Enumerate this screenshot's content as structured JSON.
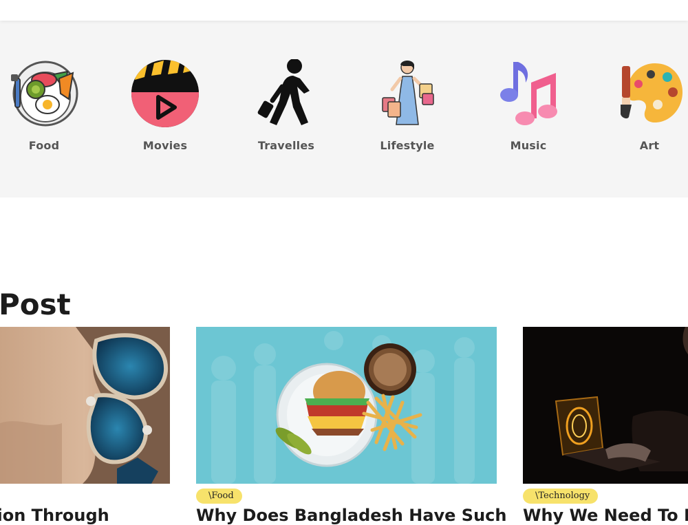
{
  "categories": [
    {
      "label": "Food",
      "icon": "food-plate-icon"
    },
    {
      "label": "Movies",
      "icon": "clapperboard-play-icon"
    },
    {
      "label": "Travelles",
      "icon": "walking-traveler-icon"
    },
    {
      "label": "Lifestyle",
      "icon": "shopping-woman-icon"
    },
    {
      "label": "Music",
      "icon": "music-notes-icon"
    },
    {
      "label": "Art",
      "icon": "paint-palette-icon"
    }
  ],
  "section": {
    "title": "Post"
  },
  "posts": [
    {
      "tag": "",
      "title": "tion Through",
      "image": "painted-cave-artwork"
    },
    {
      "tag": "\\Food",
      "title": "Why Does Bangladesh Have Such",
      "image": "burger-fries-plate"
    },
    {
      "tag": "\\Technology",
      "title": "Why We Need To Be",
      "image": "hacker-laptop-dark"
    }
  ],
  "colors": {
    "tag_bg": "#f7e26b",
    "band_bg": "#f5f5f5",
    "teal": "#6cc6d3"
  }
}
